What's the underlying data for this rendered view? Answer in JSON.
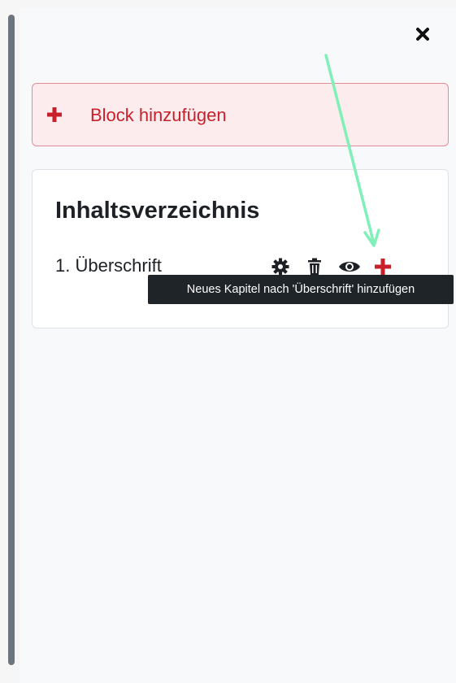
{
  "add_block": {
    "label": "Block hinzufügen",
    "icon": "plus-icon"
  },
  "toc": {
    "title": "Inhaltsverzeichnis",
    "chapters": [
      {
        "label": "1. Überschrift",
        "actions": [
          "gear-icon",
          "trash-icon",
          "eye-icon",
          "plus-icon"
        ]
      }
    ]
  },
  "tooltip": {
    "text": "Neues Kapitel nach 'Überschrift' hinzufügen"
  },
  "colors": {
    "accent_red": "#c8202b",
    "annotation_arrow": "#7ef0b8",
    "tooltip_bg": "#1f2429"
  }
}
